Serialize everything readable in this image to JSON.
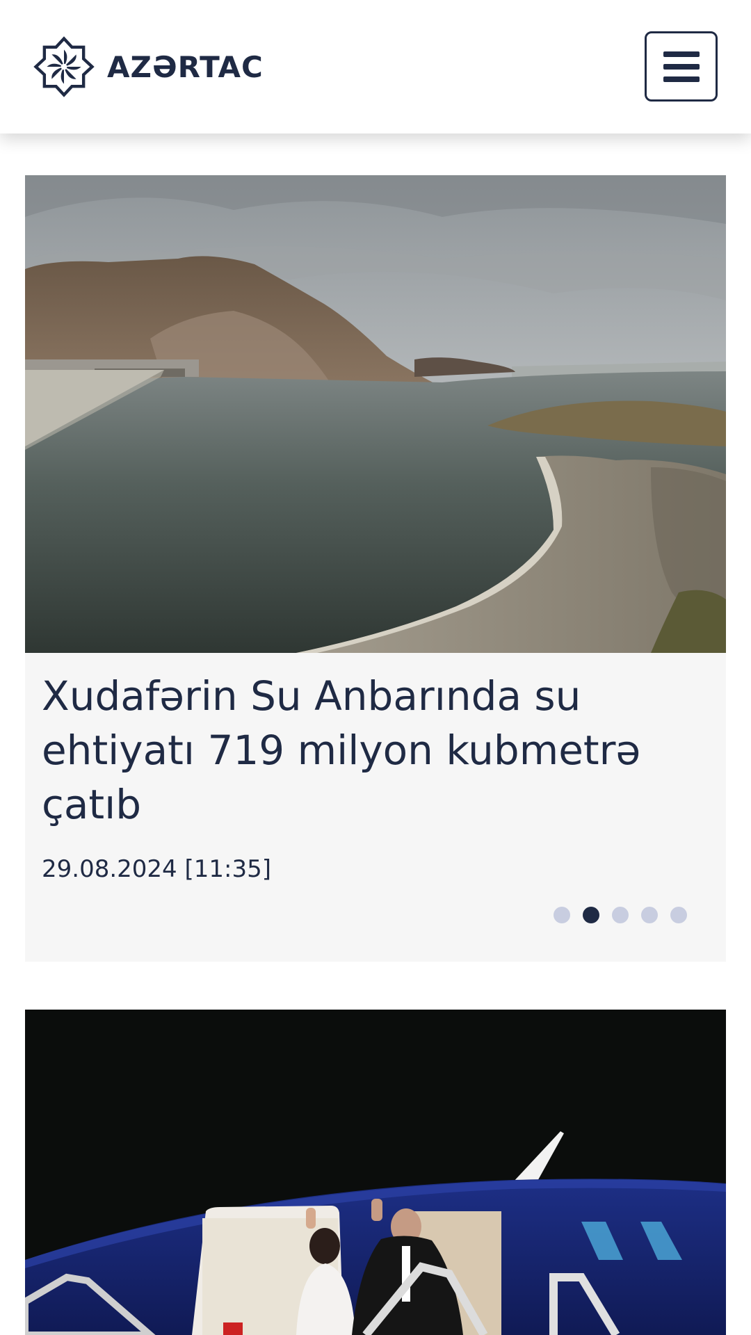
{
  "header": {
    "brand": "AZƏRTAC",
    "logo_icon": "azertac-logo-icon",
    "menu_icon": "hamburger-menu-icon"
  },
  "featured": {
    "title": "Xudafərin Su Anbarında su ehtiyatı 719 milyon kubmetrə çatıb",
    "date": "29.08.2024 [11:35]",
    "carousel": {
      "total": 5,
      "active_index": 2
    }
  },
  "second_article": {
    "image": "airplane-departure-photo"
  },
  "colors": {
    "brand": "#1f2a44",
    "card_bg": "#f6f6f6",
    "dot_inactive": "#c8cde0"
  }
}
